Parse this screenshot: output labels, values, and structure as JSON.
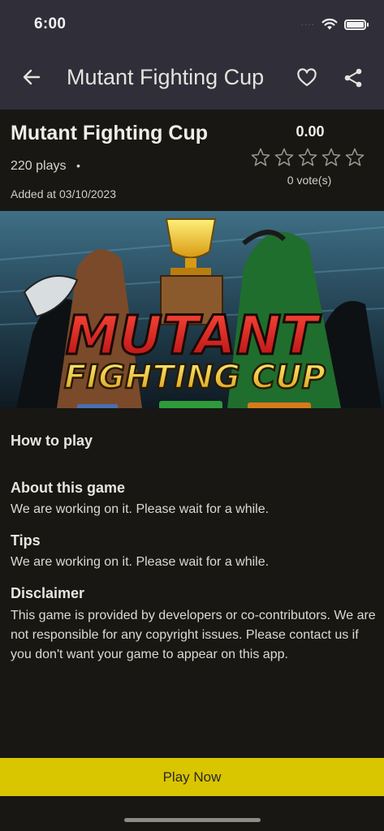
{
  "status_bar": {
    "time": "6:00",
    "dots": "····",
    "icons": [
      "wifi-icon",
      "battery-icon"
    ]
  },
  "app_bar": {
    "title": "Mutant Fighting Cup",
    "icons": [
      "back-arrow-icon",
      "heart-icon",
      "share-icon"
    ]
  },
  "game": {
    "title": "Mutant Fighting Cup",
    "plays": "220 plays",
    "separator": "•",
    "added": "Added at 03/10/2023",
    "rating": "0.00",
    "stars_filled": 0,
    "stars_total": 5,
    "votes": "0 vote(s)"
  },
  "banner": {
    "logo_line1": "MUTANT",
    "logo_line2": "FIGHTING CUP"
  },
  "sections": {
    "how_to_play": "How to play",
    "about_title": "About this game",
    "about_text": "We are working on it. Please wait for a while.",
    "tips_title": "Tips",
    "tips_text": "We are working on it. Please wait for a while.",
    "disclaimer_title": "Disclaimer",
    "disclaimer_text": "This game is provided by developers or co-contributors. We are not responsible for any copyright issues. Please contact us if you don't want your game to appear on this app."
  },
  "actions": {
    "play_now": "Play Now"
  },
  "colors": {
    "background": "#181713",
    "top_bar": "#2f2e39",
    "accent": "#d9c500"
  }
}
